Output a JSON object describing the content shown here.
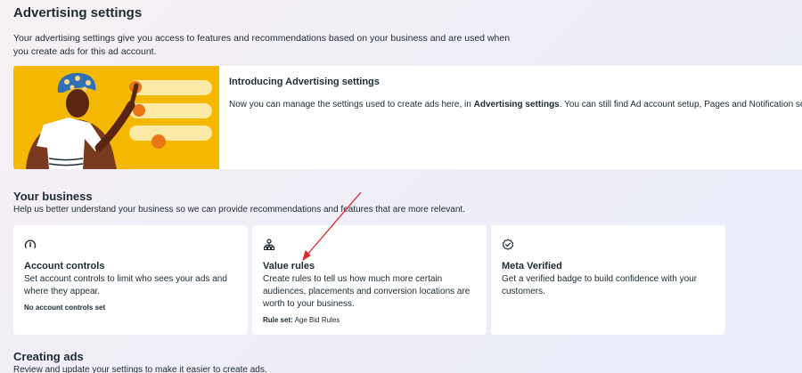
{
  "header": {
    "title": "Advertising settings",
    "description": "Your advertising settings give you access to features and recommendations based on your business and are used when you create ads for this ad account."
  },
  "intro": {
    "title": "Introducing Advertising settings",
    "text_before": "Now you can manage the settings used to create ads here, in ",
    "text_bold": "Advertising settings",
    "text_after": ". You can still find Ad account setup, Pages and Notification settings"
  },
  "your_business": {
    "title": "Your business",
    "description": "Help us better understand your business so we can provide recommendations and features that are more relevant.",
    "cards": [
      {
        "icon": "gauge-icon",
        "title": "Account controls",
        "description": "Set account controls to limit who sees your ads and where they appear.",
        "meta": "No account controls set"
      },
      {
        "icon": "hierarchy-icon",
        "title": "Value rules",
        "description": "Create rules to tell us how much more certain audiences, placements and conversion locations are worth to your business.",
        "meta_label": "Rule set:",
        "meta_value": "Age Bid Rules"
      },
      {
        "icon": "verified-badge-icon",
        "title": "Meta Verified",
        "description": "Get a verified badge to build confidence with your customers."
      }
    ]
  },
  "creating_ads": {
    "title": "Creating ads",
    "description": "Review and update your settings to make it easier to create ads."
  },
  "colors": {
    "illustration_bg": "#f5b800",
    "arrow": "#e0242a",
    "text": "#1c2b33"
  }
}
